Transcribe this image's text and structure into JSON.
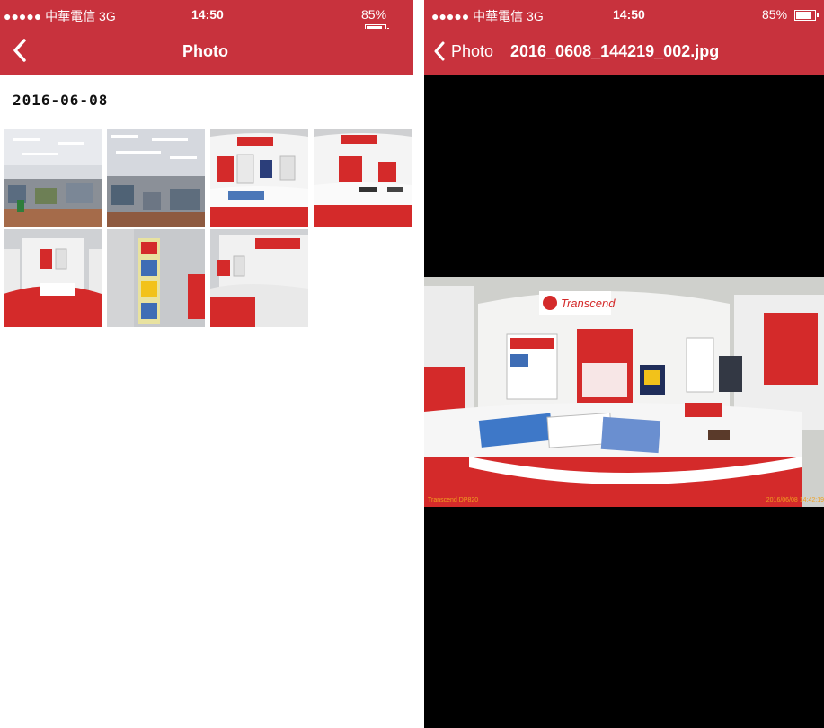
{
  "left": {
    "status": {
      "signal": "●●●●● 中華電信  3G",
      "time": "14:50",
      "battery": "85%",
      "battery_level": 0.85
    },
    "nav": {
      "back": "<",
      "title": "Photo"
    },
    "date": "2016-06-08",
    "thumbnails": [
      "office",
      "office",
      "booth",
      "booth",
      "booth",
      "banner",
      "booth"
    ]
  },
  "right": {
    "status": {
      "signal": "●●●●● 中華電信  3G",
      "time": "14:50",
      "battery": "85%",
      "battery_level": 0.85
    },
    "nav": {
      "back_label": "Photo",
      "filename": "2016_0608_144219_002.jpg"
    },
    "photo_caption_left": "Transcend DP820",
    "photo_caption_right": "2016/06/08 14:42:19",
    "logo_text": "Transcend"
  },
  "colors": {
    "accent": "#c8323d",
    "booth_red": "#d42a2a"
  }
}
